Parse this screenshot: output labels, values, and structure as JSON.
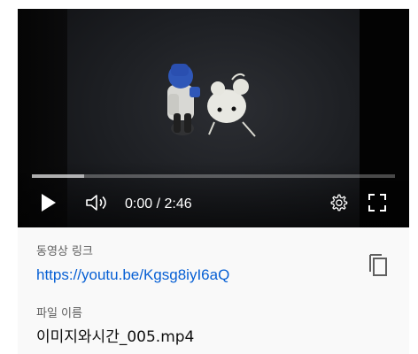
{
  "player": {
    "time_display": "0:00 / 2:46",
    "progress": {
      "played_fraction": 0.0,
      "buffered_fraction": 0.145
    },
    "icons": {
      "play": "play-icon",
      "volume": "volume-icon",
      "settings": "gear-icon",
      "fullscreen": "fullscreen-icon"
    }
  },
  "info": {
    "video_link_label": "동영상 링크",
    "video_link_url": "https://youtu.be/Kgsg8iyI6aQ",
    "copy_icon": "copy-icon",
    "file_name_label": "파일 이름",
    "file_name": "이미지와시간_005.mp4"
  },
  "colors": {
    "link": "#065fd4",
    "panel_background": "#f9f9f9",
    "player_background": "#000000"
  }
}
